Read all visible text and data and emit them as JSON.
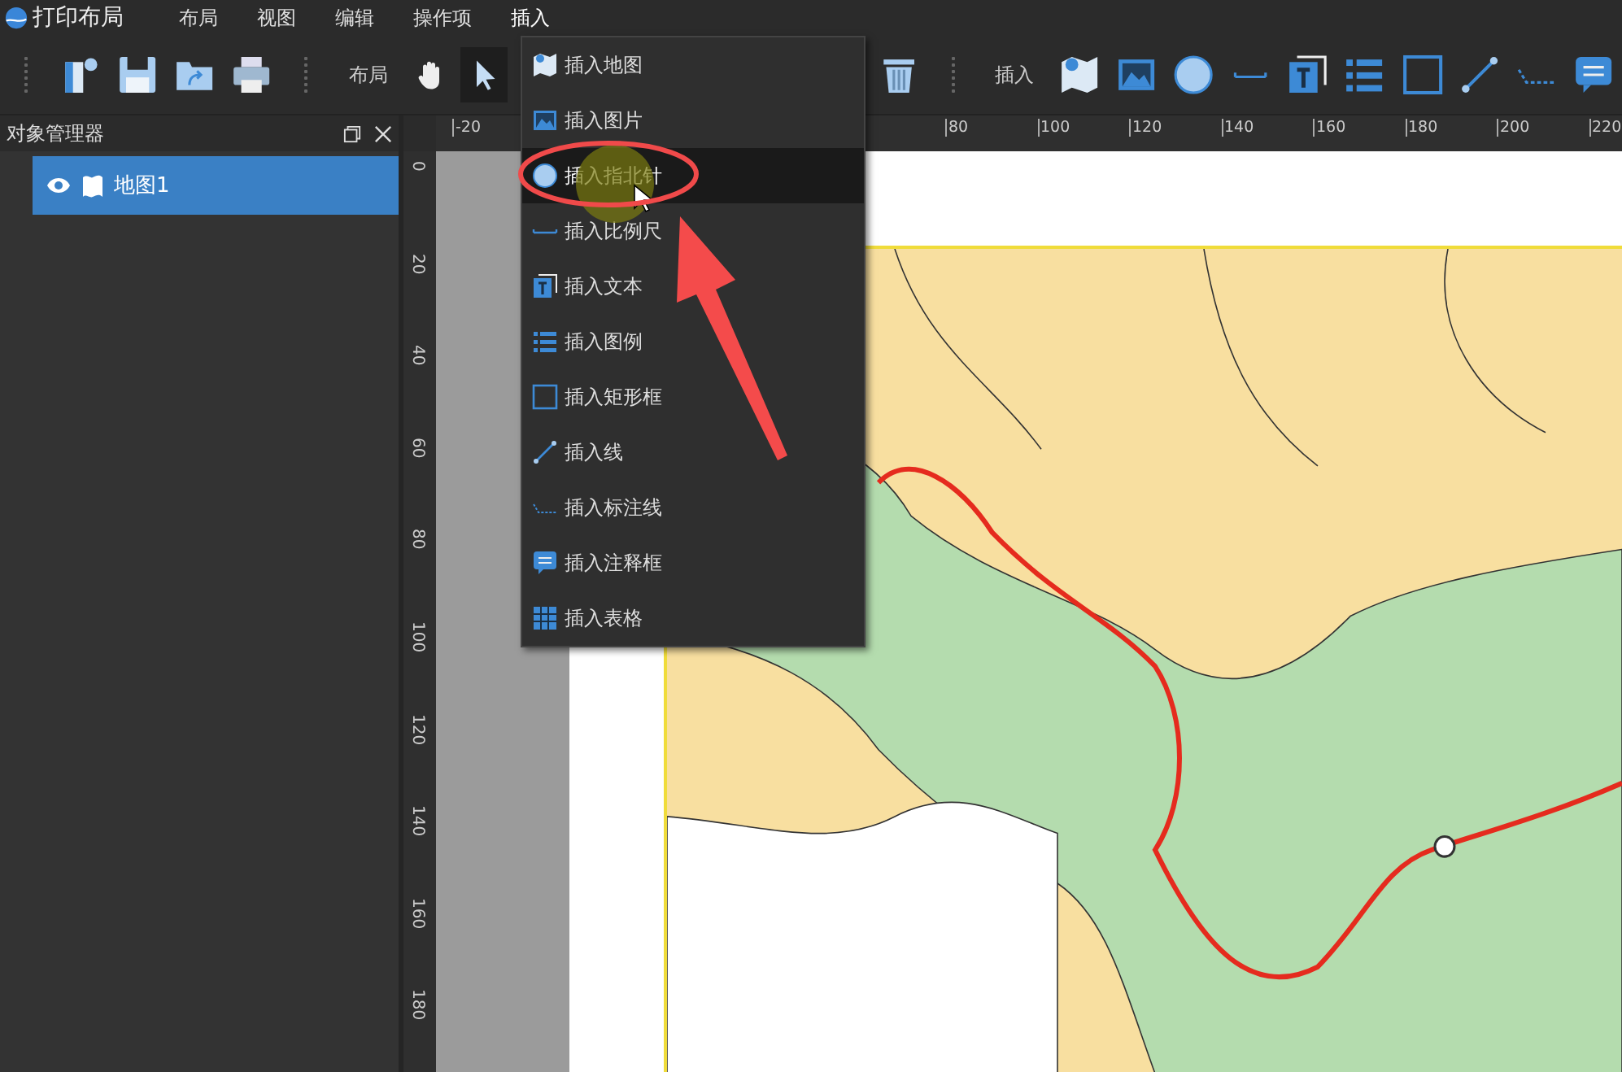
{
  "app": {
    "title": "打印布局"
  },
  "menu": [
    {
      "label": "布局",
      "selected": false
    },
    {
      "label": "视图",
      "selected": false
    },
    {
      "label": "编辑",
      "selected": false
    },
    {
      "label": "操作项",
      "selected": false
    },
    {
      "label": "插入",
      "selected": true
    }
  ],
  "toolbar": {
    "layout_label": "布局",
    "tools": [
      {
        "selected": false
      },
      {
        "selected": true
      }
    ],
    "insert_label": "插入"
  },
  "object_panel": {
    "title": "对象管理器",
    "items": [
      {
        "label": "地图1",
        "selected": true,
        "visible": true
      }
    ]
  },
  "top_ruler": [
    "-20",
    "80",
    "100",
    "120",
    "140",
    "160",
    "180",
    "200",
    "220"
  ],
  "left_ruler": [
    "0",
    "20",
    "40",
    "60",
    "80",
    "100",
    "120",
    "140",
    "160",
    "180"
  ],
  "insert_menu": [
    {
      "label": "插入地图",
      "highlighted": false
    },
    {
      "label": "插入图片",
      "highlighted": false
    },
    {
      "label": "插入指北针",
      "highlighted": true
    },
    {
      "label": "插入比例尺",
      "highlighted": false
    },
    {
      "label": "插入文本",
      "highlighted": false
    },
    {
      "label": "插入图例",
      "highlighted": false
    },
    {
      "label": "插入矩形框",
      "highlighted": false
    },
    {
      "label": "插入线",
      "highlighted": false
    },
    {
      "label": "插入标注线",
      "highlighted": false
    },
    {
      "label": "插入注释框",
      "highlighted": false
    },
    {
      "label": "插入表格",
      "highlighted": false
    }
  ]
}
